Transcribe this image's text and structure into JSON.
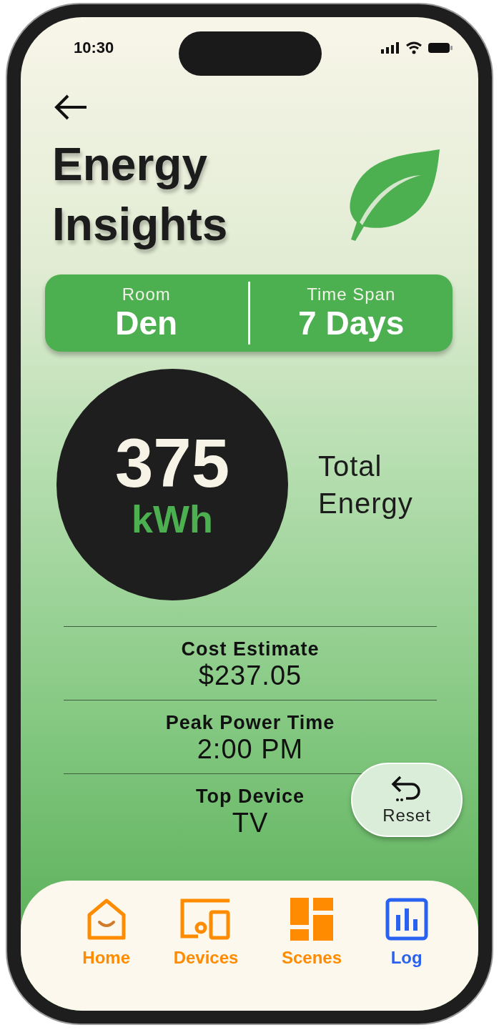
{
  "status_bar": {
    "time": "10:30"
  },
  "title": "Energy Insights",
  "selectors": [
    {
      "label": "Room",
      "value": "Den"
    },
    {
      "label": "Time Span",
      "value": "7 Days"
    }
  ],
  "total": {
    "value": "375",
    "unit": "kWh",
    "label": "Total Energy"
  },
  "stats": [
    {
      "label": "Cost Estimate",
      "value": "$237.05"
    },
    {
      "label": "Peak Power Time",
      "value": "2:00 PM"
    },
    {
      "label": "Top Device",
      "value": "TV"
    }
  ],
  "reset_button": {
    "label": "Reset"
  },
  "nav": [
    {
      "label": "Home",
      "kind": "home",
      "selected": false
    },
    {
      "label": "Devices",
      "kind": "devices",
      "selected": false
    },
    {
      "label": "Scenes",
      "kind": "scenes",
      "selected": false
    },
    {
      "label": "Log",
      "kind": "log",
      "selected": true
    }
  ]
}
